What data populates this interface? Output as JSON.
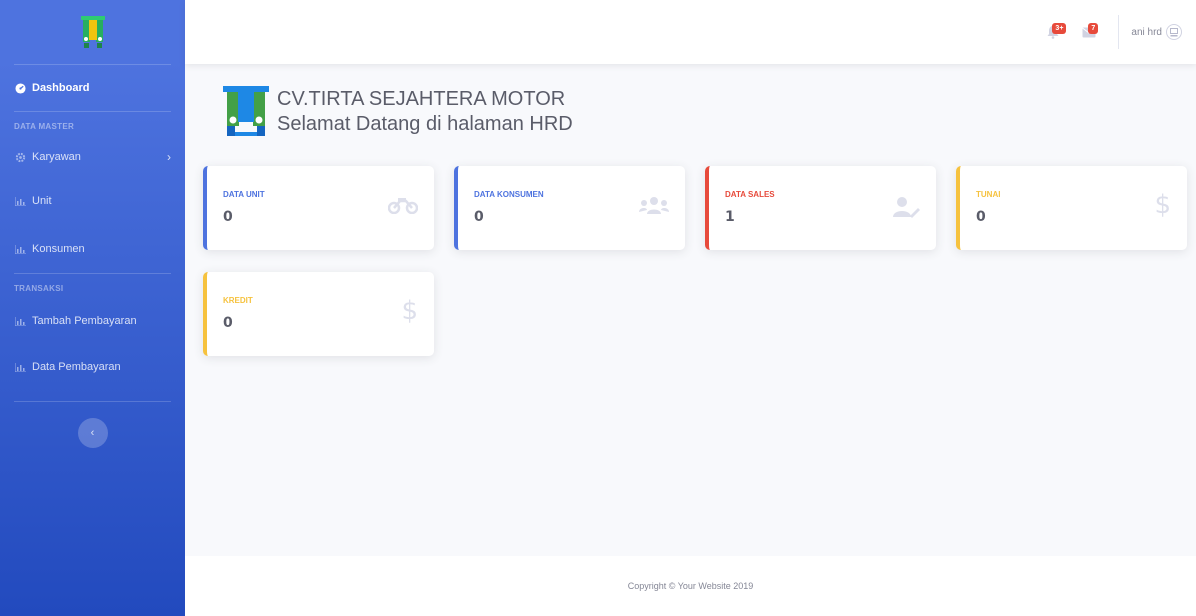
{
  "sidebar": {
    "dashboard": "Dashboard",
    "heading_master": "DATA MASTER",
    "karyawan": "Karyawan",
    "unit": "Unit",
    "konsumen": "Konsumen",
    "heading_transaksi": "TRANSAKSI",
    "tambah_pembayaran": "Tambah Pembayaran",
    "data_pembayaran": "Data Pembayaran"
  },
  "topbar": {
    "alerts_badge": "3+",
    "messages_badge": "7",
    "user_name": "ani hrd"
  },
  "header": {
    "company": "CV.TIRTA SEJAHTERA MOTOR",
    "welcome": "Selamat Datang di halaman HRD"
  },
  "cards": [
    {
      "label": "DATA UNIT",
      "value": "0",
      "color": "#4e73df",
      "icon": "motorcycle-icon"
    },
    {
      "label": "DATA KONSUMEN",
      "value": "0",
      "color": "#4e73df",
      "icon": "users-icon"
    },
    {
      "label": "DATA SALES",
      "value": "1",
      "color": "#e74a3b",
      "icon": "user-edit-icon"
    },
    {
      "label": "TUNAI",
      "value": "0",
      "color": "#f6c23e",
      "icon": "dollar-icon"
    },
    {
      "label": "KREDIT",
      "value": "0",
      "color": "#f6c23e",
      "icon": "dollar-icon"
    }
  ],
  "footer": {
    "copyright": "Copyright © Your Website 2019"
  }
}
